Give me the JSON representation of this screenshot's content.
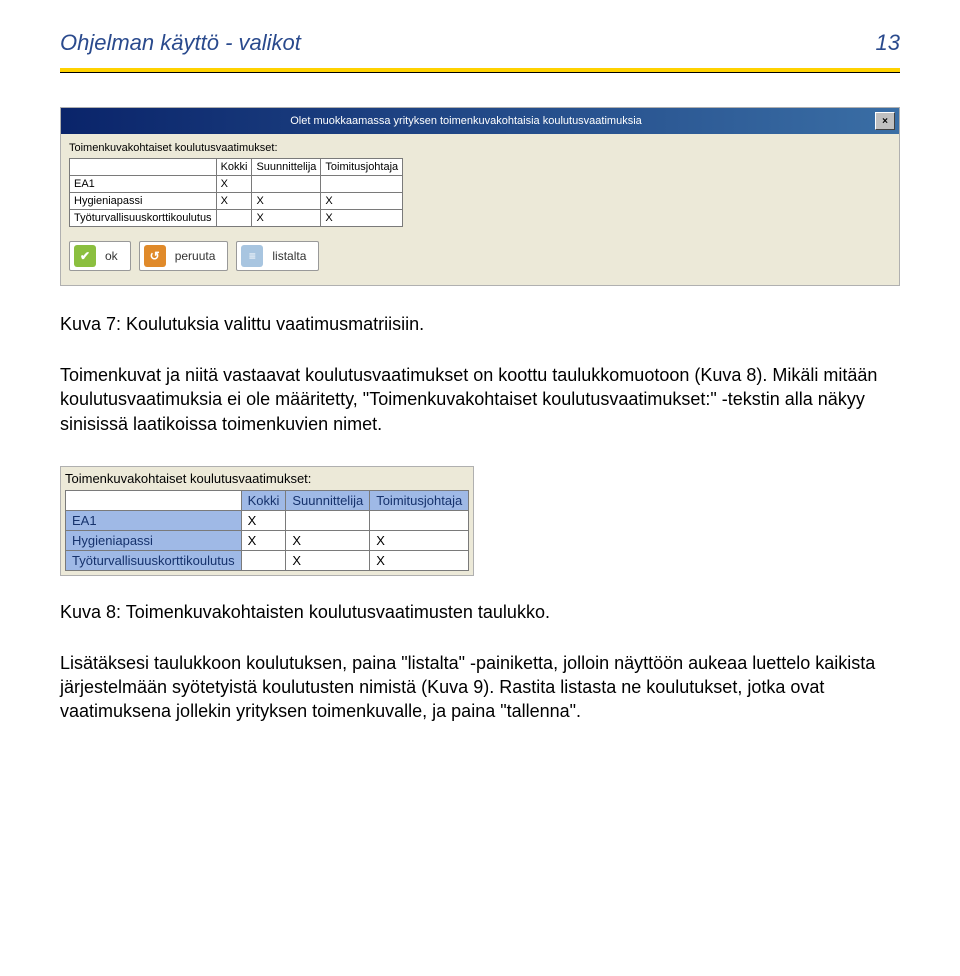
{
  "header": {
    "title": "Ohjelman käyttö -   valikot",
    "page_number": "13"
  },
  "dialog": {
    "titlebar": "Olet muokkaamassa yrityksen toimenkuvakohtaisia koulutusvaatimuksia",
    "matrix_label": "Toimenkuvakohtaiset koulutusvaatimukset:",
    "columns": [
      "Kokki",
      "Suunnittelija",
      "Toimitusjohtaja"
    ],
    "rows": [
      {
        "label": "EA1",
        "cells": [
          "X",
          "",
          ""
        ]
      },
      {
        "label": "Hygieniapassi",
        "cells": [
          "X",
          "X",
          "X"
        ]
      },
      {
        "label": "Työturvallisuuskorttikoulutus",
        "cells": [
          "",
          "X",
          "X"
        ]
      }
    ],
    "buttons": {
      "ok": "ok",
      "cancel": "peruuta",
      "list": "listalta"
    }
  },
  "caption1": "Kuva 7: Koulutuksia valittu vaatimusmatriisiin.",
  "para1": "Toimenkuvat ja niitä vastaavat koulutusvaatimukset on koottu taulukkomuotoon (Kuva 8). Mikäli mitään koulutusvaatimuksia ei ole määritetty, \"Toimenkuvakohtaiset koulutusvaatimukset:\" -tekstin alla näkyy sinisissä laatikoissa toimenkuvien nimet.",
  "matrix2": {
    "label": "Toimenkuvakohtaiset koulutusvaatimukset:",
    "columns": [
      "Kokki",
      "Suunnittelija",
      "Toimitusjohtaja"
    ],
    "rows": [
      {
        "label": "EA1",
        "cells": [
          "X",
          "",
          ""
        ]
      },
      {
        "label": "Hygieniapassi",
        "cells": [
          "X",
          "X",
          "X"
        ]
      },
      {
        "label": "Työturvallisuuskorttikoulutus",
        "cells": [
          "",
          "X",
          "X"
        ]
      }
    ]
  },
  "caption2": "Kuva 8: Toimenkuvakohtaisten koulutusvaatimusten taulukko.",
  "para2": "Lisätäksesi taulukkoon koulutuksen, paina \"listalta\" -painiketta, jolloin näyttöön aukeaa luettelo kaikista järjestelmään syötetyistä koulutusten nimistä (Kuva 9). Rastita listasta ne koulutukset, jotka ovat vaatimuksena jollekin yrityksen toimenkuvalle, ja paina \"tallenna\"."
}
